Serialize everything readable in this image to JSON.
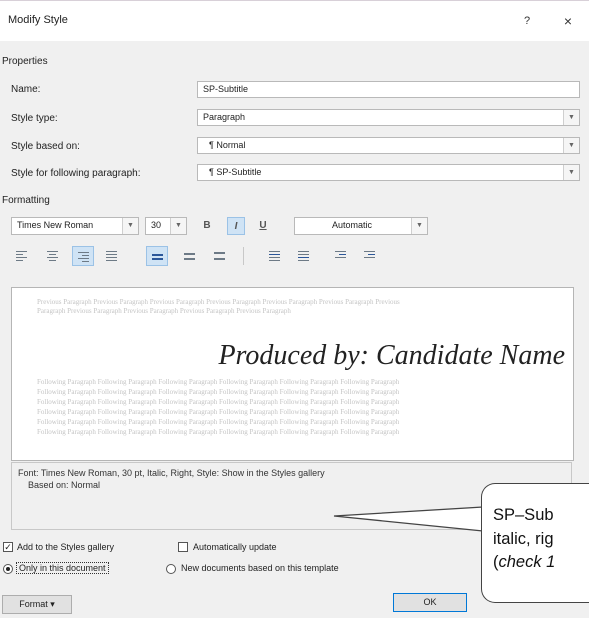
{
  "window": {
    "title": "Modify Style",
    "help_label": "?",
    "close_label": "×"
  },
  "properties": {
    "group_label": "Properties",
    "name_label": "Name:",
    "name_value": "SP-Subtitle",
    "style_type_label": "Style type:",
    "style_type_value": "Paragraph",
    "based_on_label": "Style based on:",
    "based_on_value": "¶ Normal",
    "following_label": "Style for following paragraph:",
    "following_value": "¶ SP-Subtitle"
  },
  "formatting": {
    "group_label": "Formatting",
    "font_value": "Times New Roman",
    "size_value": "30",
    "bold_label": "B",
    "italic_label": "I",
    "underline_label": "U",
    "color_value": "Automatic",
    "italic_active": true,
    "alignment_active": "right"
  },
  "preview": {
    "previous_text": [
      "Previous Paragraph Previous Paragraph Previous Paragraph Previous Paragraph Previous Paragraph Previous Paragraph Previous",
      "Paragraph Previous Paragraph Previous Paragraph Previous Paragraph Previous Paragraph"
    ],
    "sample_text": "Produced by: Candidate Name",
    "following_text": [
      "Following Paragraph Following Paragraph Following Paragraph Following Paragraph Following Paragraph Following Paragraph",
      "Following Paragraph Following Paragraph Following Paragraph Following Paragraph Following Paragraph Following Paragraph",
      "Following Paragraph Following Paragraph Following Paragraph Following Paragraph Following Paragraph Following Paragraph",
      "Following Paragraph Following Paragraph Following Paragraph Following Paragraph Following Paragraph Following Paragraph",
      "Following Paragraph Following Paragraph Following Paragraph Following Paragraph Following Paragraph Following Paragraph",
      "Following Paragraph Following Paragraph Following Paragraph Following Paragraph Following Paragraph Following Paragraph"
    ]
  },
  "description": {
    "line1": "Font: Times New Roman, 30 pt, Italic, Right, Style: Show in the Styles gallery",
    "line2": "Based on: Normal"
  },
  "options": {
    "add_to_gallery_label": "Add to the Styles gallery",
    "add_to_gallery_checked": true,
    "auto_update_label": "Automatically update",
    "auto_update_checked": false,
    "only_this_doc_label": "Only in this document",
    "new_docs_label": "New documents based on this template",
    "selected_scope": "only_this_document"
  },
  "buttons": {
    "format_label": "Format ▾",
    "ok_label": "OK"
  },
  "callout": {
    "line1": "SP–Sub",
    "line2": "italic, rig",
    "line3_open": "(",
    "line3_italic": "check 1"
  },
  "colors": {
    "dialog_bg": "#f0f0f0",
    "active_blue": "#cfe3f5",
    "preview_gray": "#c4c4c4"
  }
}
